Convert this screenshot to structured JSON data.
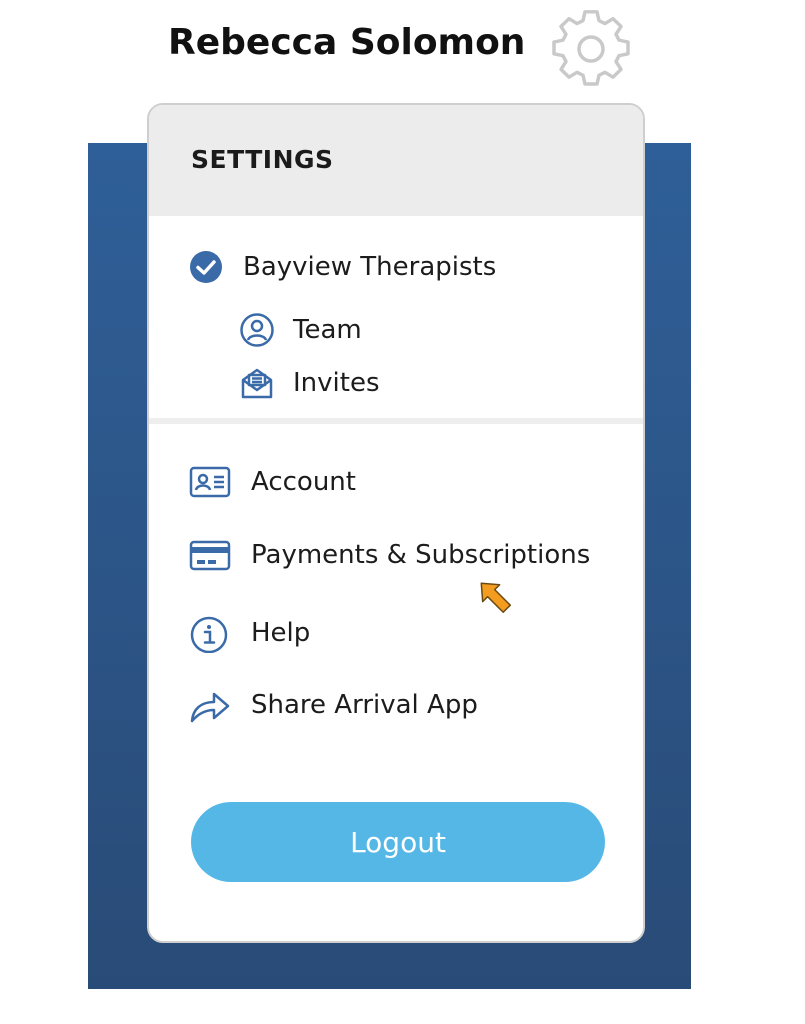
{
  "header": {
    "user_name": "Rebecca Solomon",
    "settings_icon": "gear-icon"
  },
  "settings_menu": {
    "title": "SETTINGS",
    "organization": {
      "label": "Bayview Therapists",
      "icon": "check-circle-icon",
      "selected": true,
      "sub_items": [
        {
          "label": "Team",
          "icon": "person-circle-icon"
        },
        {
          "label": "Invites",
          "icon": "envelope-open-icon"
        }
      ]
    },
    "items": [
      {
        "label": "Account",
        "icon": "id-card-icon"
      },
      {
        "label": "Payments & Subscriptions",
        "icon": "credit-card-icon"
      },
      {
        "label": "Help",
        "icon": "info-circle-icon"
      },
      {
        "label": "Share Arrival App",
        "icon": "share-arrow-icon"
      }
    ],
    "logout_label": "Logout"
  },
  "colors": {
    "accent_blue": "#2f5f98",
    "logout_button": "#55b7e6",
    "icon_blue": "#3a6aa8",
    "cursor_orange": "#f39c1f"
  }
}
